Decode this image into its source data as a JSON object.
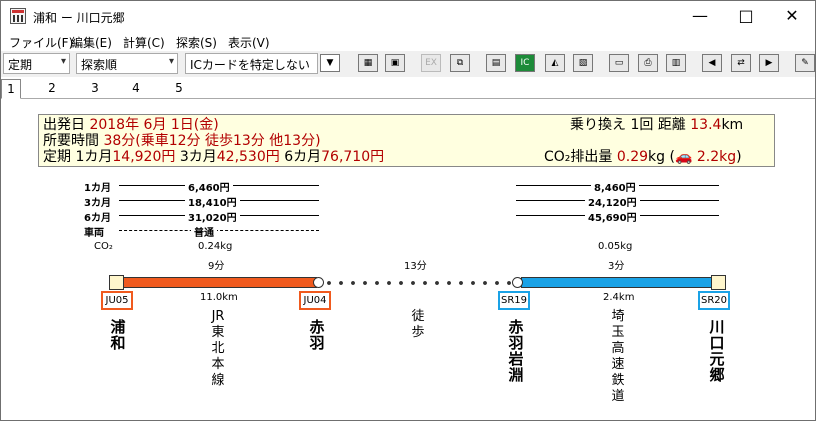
{
  "window": {
    "title": "浦和 ー 川口元郷",
    "minimize": "—",
    "maximize": "□",
    "close": "✕"
  },
  "menu": [
    "ファイル(F)",
    "編集(E)",
    "計算(C)",
    "探索(S)",
    "表示(V)"
  ],
  "toolbar": {
    "pass_select": "定期",
    "search_order_select": "探索順",
    "ic_card_select": "ICカードを特定しない",
    "ex_button": "EX",
    "ic_button": "IC"
  },
  "tabs": [
    "1",
    "2",
    "3",
    "4",
    "5"
  ],
  "summary": {
    "departure_label": "出発日",
    "departure_value": "2018年 6月 1日(金)",
    "transfer_text": "乗り換え 1回",
    "distance_label": "距離",
    "distance_value": "13.4",
    "distance_unit": "km",
    "time_label": "所要時間",
    "time_value": "38分(乗車12分 徒歩13分 他13分)",
    "commute_label": "定期",
    "commute_1_label": "1カ月",
    "commute_1_value": "14,920円",
    "commute_3_label": "3カ月",
    "commute_3_value": "42,530円",
    "commute_6_label": "6カ月",
    "commute_6_value": "76,710円",
    "co2_label": "CO₂排出量",
    "co2_value": "0.29",
    "co2_unit": "kg",
    "co2_car": "2.2kg"
  },
  "route": {
    "labels": {
      "month1": "1カ月",
      "month3": "3カ月",
      "month6": "6カ月",
      "vehicle": "車両",
      "co2": "CO₂"
    },
    "segment1": {
      "m1": "6,460円",
      "m3": "18,410円",
      "m6": "31,020円",
      "vehicle": "普通",
      "co2": "0.24kg",
      "time": "9分",
      "distance": "11.0km",
      "line": "JR東北本線",
      "color": "#f05a1e"
    },
    "walk": {
      "time": "13分",
      "label": "徒歩"
    },
    "segment2": {
      "m1": "8,460円",
      "m3": "24,120円",
      "m6": "45,690円",
      "co2": "0.05kg",
      "time": "3分",
      "distance": "2.4km",
      "line": "埼玉高速鉄道",
      "color": "#1aa2e6"
    },
    "stations": [
      {
        "name": "浦和",
        "code": "JU05"
      },
      {
        "name": "赤羽",
        "code": "JU04"
      },
      {
        "name": "赤羽岩淵",
        "code": "SR19"
      },
      {
        "name": "川口元郷",
        "code": "SR20"
      }
    ]
  }
}
